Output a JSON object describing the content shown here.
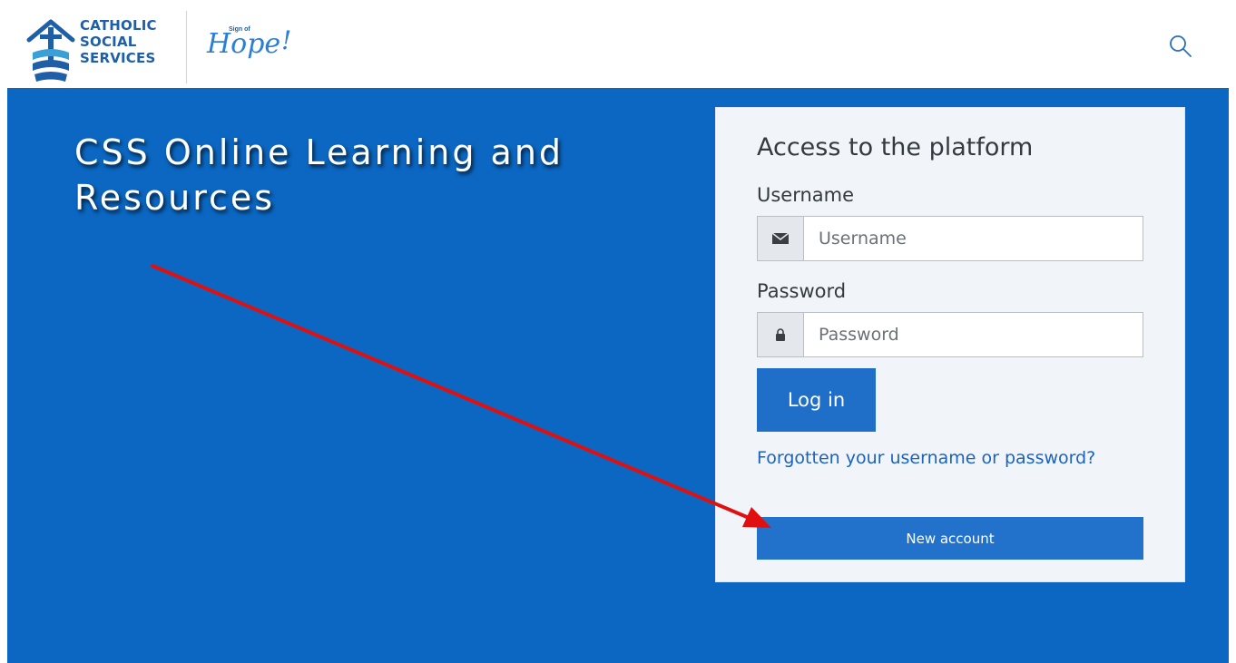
{
  "brand": {
    "org_name_line1": "CATHOLIC",
    "org_name_line2": "SOCIAL",
    "org_name_line3": "SERVICES",
    "hope_small": "Sign of",
    "hope_text": "Hope",
    "hope_mark": "!"
  },
  "header": {
    "search_icon": "search-icon"
  },
  "hero": {
    "title": "CSS Online Learning and Resources"
  },
  "login": {
    "title": "Access to the platform",
    "username_label": "Username",
    "username_placeholder": "Username",
    "username_icon": "envelope-icon",
    "password_label": "Password",
    "password_placeholder": "Password",
    "password_icon": "lock-icon",
    "login_button": "Log in",
    "forgot_link": "Forgotten your username or password?",
    "new_account_button": "New account"
  },
  "colors": {
    "hero_bg": "#0b67c2",
    "card_bg": "#f1f5f9",
    "primary_button": "#1f6fc9",
    "link": "#1a63be",
    "annotation_arrow": "#e01010"
  }
}
